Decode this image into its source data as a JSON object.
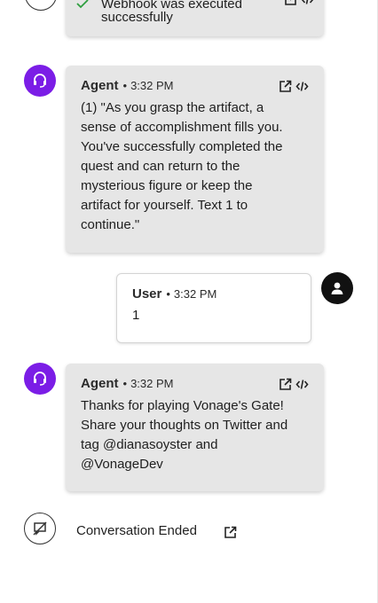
{
  "top_partial": {
    "text_line1": "Webhook was executed",
    "text_line2": "successfully"
  },
  "messages": [
    {
      "sender": "Agent",
      "dot": "•",
      "time": "3:32 PM",
      "lines": [
        "(1) \"As you grasp the artifact, a",
        "sense of accomplishment fills you.",
        "You've successfully completed the",
        "quest and can return to the",
        "mysterious figure or keep the",
        "artifact for yourself. Text 1 to",
        "continue.\""
      ]
    },
    {
      "sender": "User",
      "dot": "•",
      "time": "3:32 PM",
      "lines": [
        "1"
      ]
    },
    {
      "sender": "Agent",
      "dot": "•",
      "time": "3:32 PM",
      "lines": [
        "Thanks for playing Vonage's Gate!",
        "Share your thoughts on Twitter and",
        "tag @dianasoyster and",
        "@VonageDev"
      ]
    }
  ],
  "conversation_end": {
    "label": "Conversation Ended"
  },
  "colors": {
    "agent_avatar": "#7b1de6",
    "agent_bubble": "#e6e6e6",
    "user_avatar": "#111111",
    "check": "#2e9e3e"
  },
  "icons": {
    "agent_avatar": "headset-icon",
    "user_avatar": "person-icon",
    "open": "external-link-icon",
    "code": "code-icon",
    "ended": "chat-off-icon",
    "check": "check-icon"
  }
}
